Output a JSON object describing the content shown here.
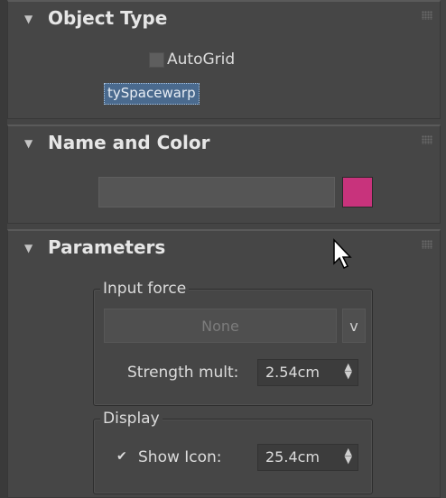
{
  "object_type": {
    "title": "Object Type",
    "autogrid_label": "AutoGrid",
    "autogrid_checked": false,
    "selected_item": "tySpacewarp"
  },
  "name_and_color": {
    "title": "Name and Color",
    "name_value": "",
    "color": "#c8337c"
  },
  "parameters": {
    "title": "Parameters",
    "input_force": {
      "group_label": "Input force",
      "button_label": "None",
      "dropdown_label": "v",
      "strength_label": "Strength mult:",
      "strength_value": "2.54cm"
    },
    "display": {
      "group_label": "Display",
      "show_icon_label": "Show Icon:",
      "show_icon_checked": true,
      "icon_size_value": "25.4cm"
    }
  },
  "icons": {
    "collapse": "▼",
    "check": "✔",
    "spinner_up": "▲",
    "spinner_down": "▼"
  }
}
